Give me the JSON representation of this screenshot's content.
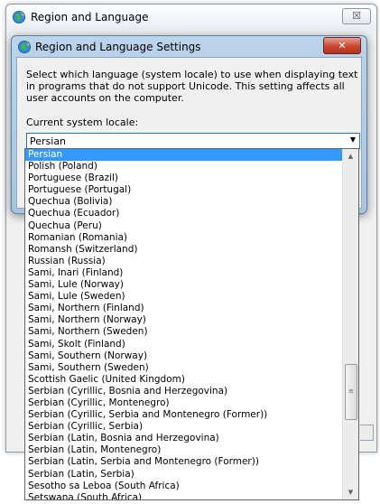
{
  "outer_window": {
    "title": "Region and Language",
    "close_label": "☒"
  },
  "dialog": {
    "title": "Region and Language Settings",
    "ghost_labels": [
      "",
      ""
    ],
    "close_label": "✕",
    "description": "Select which language (system locale) to use when displaying text in programs that do not support Unicode. This setting affects all user accounts on the computer.",
    "current_locale_label": "Current system locale:",
    "current_locale_value": "Persian",
    "combo_arrow": "▼"
  },
  "dropdown": {
    "items": [
      "Persian",
      "Polish (Poland)",
      "Portuguese (Brazil)",
      "Portuguese (Portugal)",
      "Quechua (Bolivia)",
      "Quechua (Ecuador)",
      "Quechua (Peru)",
      "Romanian (Romania)",
      "Romansh (Switzerland)",
      "Russian (Russia)",
      "Sami, Inari (Finland)",
      "Sami, Lule (Norway)",
      "Sami, Lule (Sweden)",
      "Sami, Northern (Finland)",
      "Sami, Northern (Norway)",
      "Sami, Northern (Sweden)",
      "Sami, Skolt (Finland)",
      "Sami, Southern (Norway)",
      "Sami, Southern (Sweden)",
      "Scottish Gaelic (United Kingdom)",
      "Serbian (Cyrillic, Bosnia and Herzegovina)",
      "Serbian (Cyrillic, Montenegro)",
      "Serbian (Cyrillic, Serbia and Montenegro (Former))",
      "Serbian (Cyrillic, Serbia)",
      "Serbian (Latin, Bosnia and Herzegovina)",
      "Serbian (Latin, Montenegro)",
      "Serbian (Latin, Serbia and Montenegro (Former))",
      "Serbian (Latin, Serbia)",
      "Sesotho sa Leboa (South Africa)",
      "Setswana (South Africa)"
    ],
    "selected_index": 0,
    "scroll_up": "▲",
    "scroll_down": "▼",
    "thumb_grip": "≡"
  },
  "colors": {
    "selection": "#3399ff",
    "dialog_frame": "#bcd4ea",
    "close_button": "#c9452f"
  },
  "icons": {
    "app_icon": "region-globe-icon"
  }
}
